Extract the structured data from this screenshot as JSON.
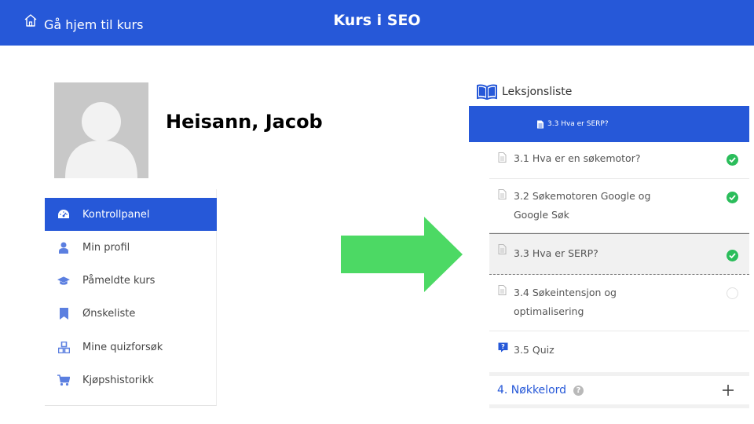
{
  "header": {
    "home_label": "Gå hjem til kurs",
    "title": "Kurs i SEO",
    "home_icon": "home-icon"
  },
  "profile": {
    "greeting": "Heisann, Jacob"
  },
  "menu": {
    "items": [
      {
        "label": "Kontrollpanel",
        "icon": "dashboard-icon",
        "active": true
      },
      {
        "label": "Min profil",
        "icon": "user-icon",
        "active": false
      },
      {
        "label": "Påmeldte kurs",
        "icon": "graduation-cap-icon",
        "active": false
      },
      {
        "label": "Ønskeliste",
        "icon": "bookmark-icon",
        "active": false
      },
      {
        "label": "Mine quizforsøk",
        "icon": "cubes-icon",
        "active": false
      },
      {
        "label": "Kjøpshistorikk",
        "icon": "cart-icon",
        "active": false
      }
    ]
  },
  "lessons": {
    "header": "Leksjonsliste",
    "current": "3.3 Hva er SERP?",
    "items": [
      {
        "title": "3.1 Hva er en søkemotor?",
        "status": "completed"
      },
      {
        "title": "3.2 Søkemotoren Google og Google Søk",
        "status": "completed"
      },
      {
        "title": "3.3 Hva er SERP?",
        "status": "completed",
        "active": true
      },
      {
        "title": "3.4 Søkeintensjon og optimalisering",
        "status": "not-started"
      },
      {
        "title": "3.5 Quiz",
        "status": "quiz"
      }
    ],
    "next_section": "4. Nøkkelord",
    "help_glyph": "?"
  },
  "colors": {
    "primary": "#2658d8",
    "success": "#2bbd5b",
    "arrow": "#4cd964",
    "menu_icon": "#5b7fe0"
  }
}
